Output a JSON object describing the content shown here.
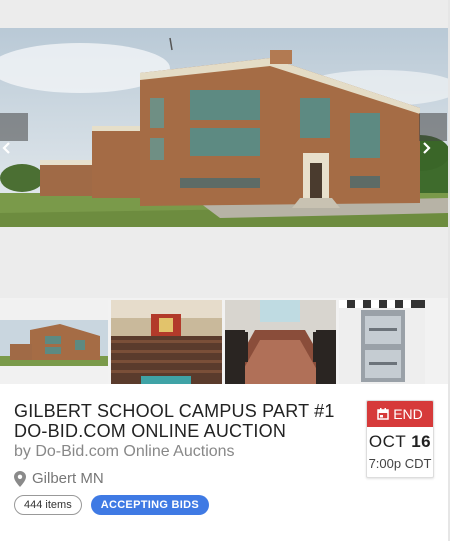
{
  "auction": {
    "title_line1": "GILBERT SCHOOL CAMPUS PART #1",
    "title_line2": "DO-BID.COM ONLINE AUCTION",
    "byline": "by Do-Bid.com Online Auctions",
    "location": "Gilbert MN",
    "items_count": "444 items",
    "status": "ACCEPTING BIDS"
  },
  "end": {
    "label": "END",
    "month": "OCT",
    "day": "16",
    "time": "7:00p CDT"
  },
  "colors": {
    "end_red": "#d63a3a",
    "status_blue": "#3f7ae4"
  },
  "icons": {
    "prev": "chevron-left-icon",
    "next": "chevron-right-icon",
    "location": "map-pin-icon",
    "calendar": "calendar-icon"
  }
}
